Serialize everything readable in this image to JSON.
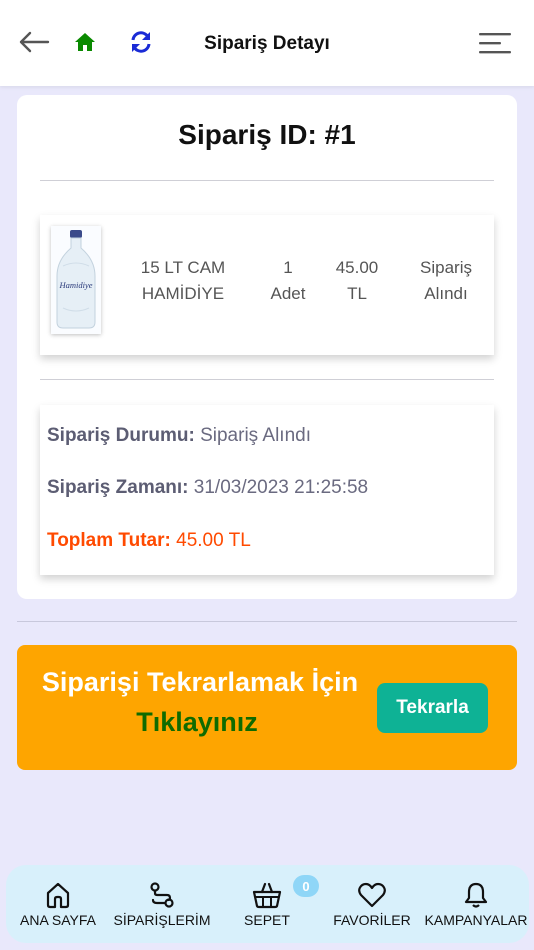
{
  "header": {
    "title": "Sipariş Detayı",
    "icons": [
      "back-arrow-icon",
      "home-icon",
      "refresh-icon",
      "menu-icon"
    ],
    "colors": {
      "home": "#0a8a00",
      "refresh": "#1a2bd6"
    }
  },
  "order": {
    "id_label": "Sipariş ID: #1",
    "product": {
      "name_line1": "15 LT CAM",
      "name_line2": "HAMİDİYE",
      "qty_line1": "1",
      "qty_line2": "Adet",
      "price_line1": "45.00",
      "price_line2": "TL",
      "status_line1": "Sipariş",
      "status_line2": "Alındı",
      "image_brand": "Hamidiye"
    },
    "status_label": "Sipariş Durumu:",
    "status_value": "Sipariş Alındı",
    "time_label": "Sipariş Zamanı:",
    "time_value": "31/03/2023 21:25:58",
    "total_label": "Toplam Tutar:",
    "total_value": "45.00 TL"
  },
  "repeat": {
    "line1": "Siparişi Tekrarlamak İçin",
    "line2": "Tıklayınız",
    "button_label": "Tekrarla",
    "colors": {
      "banner": "#fea500",
      "button": "#0eb295",
      "line2": "#0f6b00"
    }
  },
  "bottom_nav": {
    "items": [
      {
        "label": "ANA SAYFA",
        "icon": "home-outline-icon"
      },
      {
        "label": "SİPARİŞLERİM",
        "icon": "route-icon"
      },
      {
        "label": "SEPET",
        "icon": "basket-icon"
      },
      {
        "label": "FAVORİLER",
        "icon": "heart-icon"
      },
      {
        "label": "KAMPANYALAR",
        "icon": "bell-icon"
      }
    ],
    "cart_count": "0"
  }
}
